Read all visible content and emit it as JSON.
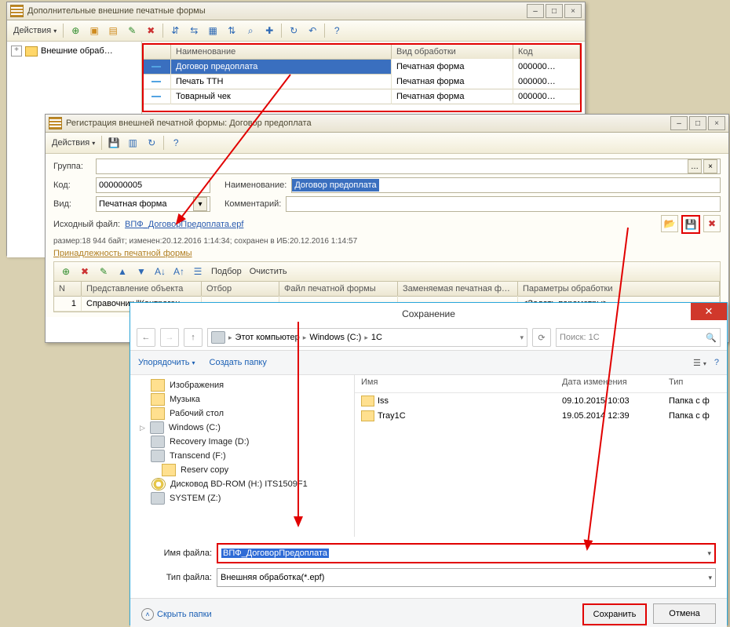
{
  "win1": {
    "title": "Дополнительные внешние печатные формы",
    "actions": "Действия",
    "tree_root": "Внешние обраб…",
    "grid": {
      "headers": {
        "name": "Наименование",
        "type": "Вид обработки",
        "code": "Код"
      },
      "rows": [
        {
          "name": "Договор предоплата",
          "type": "Печатная форма",
          "code": "000000…"
        },
        {
          "name": "Печать ТТН",
          "type": "Печатная форма",
          "code": "000000…"
        },
        {
          "name": "Товарный чек",
          "type": "Печатная форма",
          "code": "000000…"
        }
      ]
    }
  },
  "win2": {
    "title": "Регистрация внешней печатной формы: Договор предоплата",
    "actions": "Действия",
    "labels": {
      "group": "Группа:",
      "code": "Код:",
      "name": "Наименование:",
      "kind": "Вид:",
      "comment": "Комментарий:",
      "srcfile": "Исходный файл:",
      "srcfile_link": "ВПФ_ДоговорПредоплата.epf",
      "meta": "размер:18 944 байт; изменен:20.12.2016 1:14:34; сохранен в ИБ:20.12.2016 1:14:57",
      "section": "Принадлежность печатной формы",
      "selection": "Подбор",
      "clear": "Очистить"
    },
    "values": {
      "code": "000000005",
      "name_sel": "Договор предоплата",
      "kind": "Печатная форма"
    },
    "ogrid": {
      "headers": {
        "n": "N",
        "obj": "Представление объекта",
        "filter": "Отбор",
        "file": "Файл печатной формы",
        "replace": "Заменяемая печатная ф…",
        "params": "Параметры обработки"
      },
      "row": {
        "n": "1",
        "obj": "Справочник \"Контраген…",
        "filter": "",
        "file": "",
        "replace": "",
        "params": "<Задать параметры>"
      }
    }
  },
  "win3": {
    "title": "Сохранение",
    "breadcrumb": {
      "pc": "Этот компьютер",
      "c": "Windows (C:)",
      "folder": "1C"
    },
    "refresh_tip": "Обновить",
    "search_placeholder": "Поиск: 1C",
    "organize": "Упорядочить",
    "newfolder": "Создать папку",
    "tree": {
      "images": "Изображения",
      "music": "Музыка",
      "desktop": "Рабочий стол",
      "c": "Windows (C:)",
      "rec": "Recovery Image (D:)",
      "tr": "Transcend (F:)",
      "res": "Reserv copy",
      "bd": "Дисковод BD-ROM (H:) ITS1509F1",
      "sys": "SYSTEM (Z:)"
    },
    "list": {
      "headers": {
        "name": "Имя",
        "date": "Дата изменения",
        "type": "Тип"
      },
      "rows": [
        {
          "name": "Iss",
          "date": "09.10.2015 10:03",
          "type": "Папка с ф"
        },
        {
          "name": "Tray1C",
          "date": "19.05.2014 12:39",
          "type": "Папка с ф"
        }
      ]
    },
    "fields": {
      "filename_lbl": "Имя файла:",
      "filename": "ВПФ_ДоговорПредоплата",
      "filetype_lbl": "Тип файла:",
      "filetype": "Внешняя обработка(*.epf)"
    },
    "footer": {
      "hide": "Скрыть папки",
      "save": "Сохранить",
      "cancel": "Отмена"
    }
  }
}
